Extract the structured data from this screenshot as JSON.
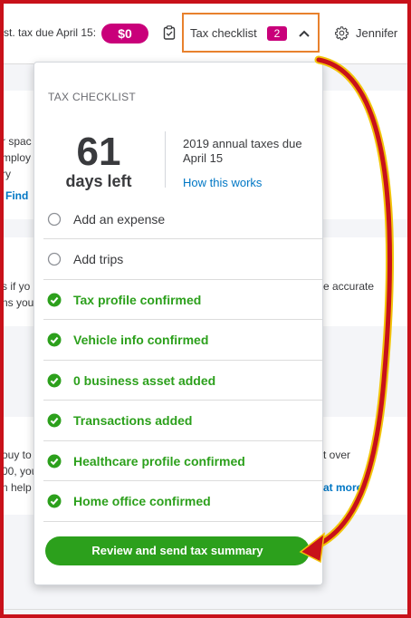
{
  "header": {
    "est_tax_label": "st. tax due April 15:",
    "est_tax_value": "$0",
    "tax_checklist_label": "Tax checklist",
    "tax_checklist_count": "2",
    "user_name": "Jennifer"
  },
  "background": {
    "fragments": [
      "r spac",
      "mploy",
      "ry",
      "Find",
      "s if yo",
      "ns you",
      "e accurate",
      "ouy to",
      "00, you",
      "n help",
      "t over",
      "at more"
    ]
  },
  "checklist": {
    "title": "TAX CHECKLIST",
    "days_number": "61",
    "days_label": "days left",
    "annual_text": "2019 annual taxes due April 15",
    "how_link": "How this works",
    "items": [
      {
        "label": "Add an expense",
        "done": false
      },
      {
        "label": "Add trips",
        "done": false
      },
      {
        "label": "Tax profile confirmed",
        "done": true
      },
      {
        "label": "Vehicle info confirmed",
        "done": true
      },
      {
        "label": "0 business asset added",
        "done": true
      },
      {
        "label": "Transactions added",
        "done": true
      },
      {
        "label": "Healthcare profile confirmed",
        "done": true
      },
      {
        "label": "Home office confirmed",
        "done": true
      }
    ],
    "review_button": "Review and send tax summary"
  },
  "colors": {
    "accent_pink": "#c9007a",
    "success_green": "#2ca01c",
    "link_blue": "#0077c5",
    "highlight_orange": "#e8812d",
    "annotation_red": "#c8111a"
  }
}
